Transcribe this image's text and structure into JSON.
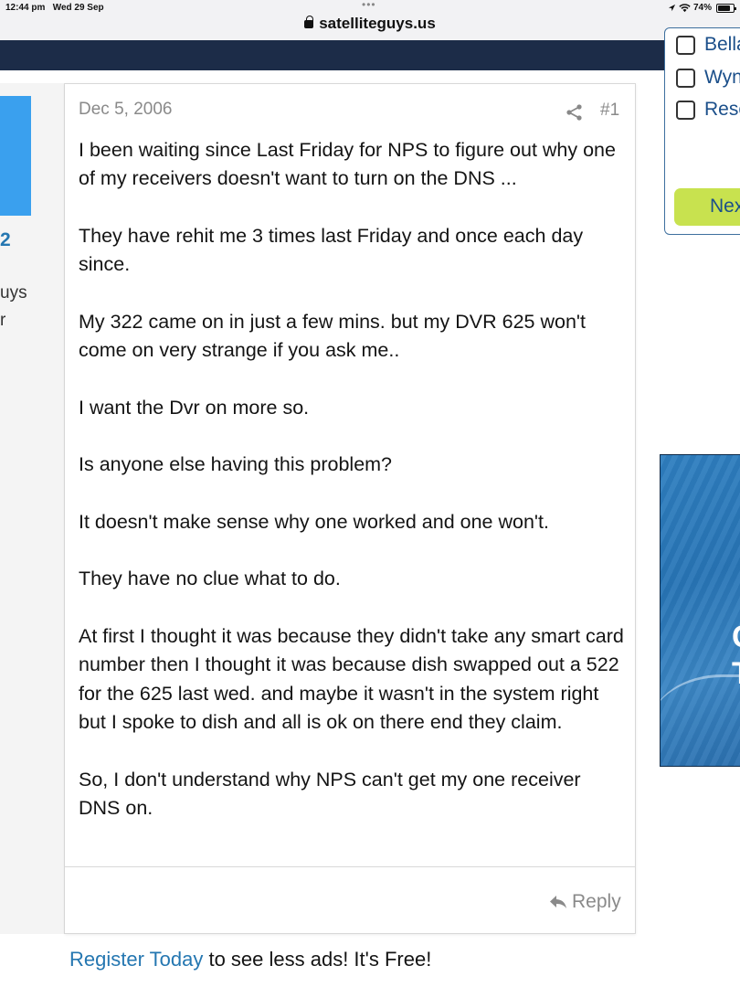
{
  "status_bar": {
    "time": "12:44 pm",
    "date": "Wed 29 Sep",
    "url": "satelliteguys.us",
    "battery": "74%"
  },
  "sidebar_user": {
    "count_fragment": "2",
    "line1_fragment": "uys",
    "line2_fragment": "r"
  },
  "post": {
    "date": "Dec 5, 2006",
    "number": "#1",
    "paragraphs": [
      "I been waiting since Last Friday for NPS to figure out why one of my receivers doesn't want to turn on the DNS ...",
      "They have rehit me 3 times last Friday and once each day since.",
      "My 322 came on in just a few mins. but my DVR 625 won't come on very strange if you ask me..",
      "I want the Dvr on more so.",
      "Is anyone else having this problem?",
      "It doesn't make sense why one worked and one won't.",
      "They have no clue what to do.",
      "At first I thought it was because they didn't take any smart card number then I thought it was because dish swapped out a 522 for the 625 last wed. and maybe it wasn't in the system right but I spoke to dish and all is ok on there end they claim.",
      "So, I don't understand why NPS can't get my one receiver DNS on."
    ],
    "reply_label": "Reply"
  },
  "register": {
    "link": "Register Today",
    "text": " to see less ads! It's Free!"
  },
  "poll": {
    "options": [
      "Bella",
      "Wyn",
      "Resc"
    ],
    "next_label": "Nex"
  },
  "ad": {
    "letter1": "C",
    "letter2": "T"
  },
  "colors": {
    "nav": "#1c2c48",
    "link": "#2577b1",
    "accent_button": "#c8e24f",
    "avatar": "#3aa0ee"
  }
}
